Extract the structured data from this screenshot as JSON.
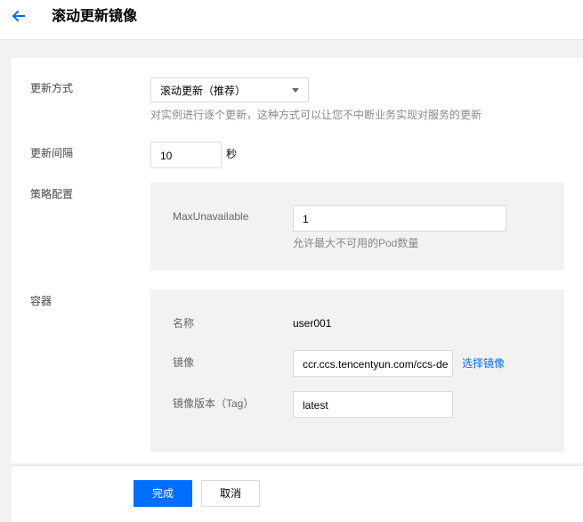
{
  "header": {
    "title": "滚动更新镜像",
    "back_icon": "arrow-left-icon"
  },
  "form": {
    "update_method": {
      "label": "更新方式",
      "selected": "滚动更新（推荐）",
      "hint": "对实例进行逐个更新，这种方式可以让您不中断业务实现对服务的更新"
    },
    "update_interval": {
      "label": "更新间隔",
      "value": "10",
      "unit": "秒"
    },
    "strategy": {
      "label": "策略配置",
      "max_unavailable_label": "MaxUnavailable",
      "max_unavailable_value": "1",
      "max_unavailable_hint": "允许最大不可用的Pod数量"
    },
    "container": {
      "label": "容器",
      "name_label": "名称",
      "name_value": "user001",
      "image_label": "镜像",
      "image_value": "ccr.ccs.tencentyun.com/ccs-de",
      "select_image_link": "选择镜像",
      "tag_label": "镜像版本（Tag）",
      "tag_value": "latest"
    }
  },
  "footer": {
    "confirm_label": "完成",
    "cancel_label": "取消"
  },
  "colors": {
    "primary": "#006eff",
    "page_bg": "#f2f2f2"
  }
}
